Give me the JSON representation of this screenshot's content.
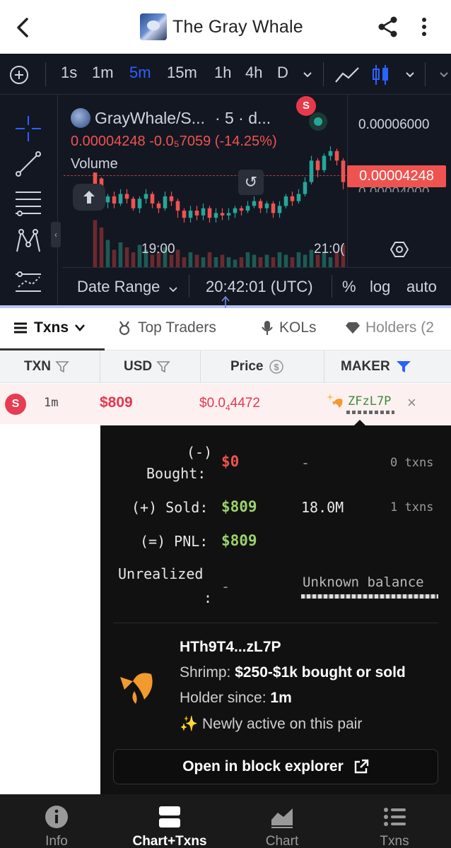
{
  "header": {
    "title": "The Gray Whale",
    "icons": [
      "back-icon",
      "share-icon",
      "more-vertical-icon"
    ]
  },
  "chart_toolbar": {
    "intervals": [
      "1s",
      "1m",
      "5m",
      "15m",
      "1h",
      "4h",
      "D"
    ],
    "active_interval": "5m"
  },
  "chart": {
    "pair": "GrayWhale/S...",
    "interval_label": "· 5 · d...",
    "s_marker": "S",
    "quote": "0.00004248 -0.0₅7059 (-14.25%)",
    "volume_label": "Volume",
    "axis_top": "0.00006000",
    "price_tag": "0.00004248",
    "price_ghost": "0.00004000",
    "x_ticks": [
      "19:00",
      "21:0("
    ],
    "candles": [
      [
        1.0,
        0.9,
        0.95,
        0.78,
        "down"
      ],
      [
        0.95,
        0.72,
        0.96,
        0.7,
        "down"
      ],
      [
        0.75,
        0.8,
        0.82,
        0.7,
        "up"
      ],
      [
        0.8,
        0.74,
        0.84,
        0.7,
        "down"
      ],
      [
        0.74,
        0.82,
        0.86,
        0.72,
        "up"
      ],
      [
        0.82,
        0.78,
        0.86,
        0.74,
        "down"
      ],
      [
        0.78,
        0.7,
        0.8,
        0.68,
        "down"
      ],
      [
        0.7,
        0.78,
        0.8,
        0.66,
        "up"
      ],
      [
        0.78,
        0.82,
        0.86,
        0.74,
        "up"
      ],
      [
        0.82,
        0.74,
        0.84,
        0.7,
        "down"
      ],
      [
        0.74,
        0.7,
        0.76,
        0.66,
        "down"
      ],
      [
        0.7,
        0.8,
        0.84,
        0.68,
        "up"
      ],
      [
        0.8,
        0.76,
        0.84,
        0.72,
        "down"
      ],
      [
        0.76,
        0.68,
        0.78,
        0.62,
        "down"
      ],
      [
        0.68,
        0.62,
        0.7,
        0.58,
        "down"
      ],
      [
        0.62,
        0.68,
        0.72,
        0.58,
        "up"
      ],
      [
        0.68,
        0.64,
        0.72,
        0.6,
        "down"
      ],
      [
        0.64,
        0.7,
        0.74,
        0.6,
        "up"
      ],
      [
        0.7,
        0.62,
        0.72,
        0.58,
        "down"
      ],
      [
        0.62,
        0.66,
        0.7,
        0.58,
        "up"
      ],
      [
        0.66,
        0.64,
        0.7,
        0.6,
        "down"
      ],
      [
        0.64,
        0.66,
        0.7,
        0.6,
        "up"
      ],
      [
        0.66,
        0.7,
        0.72,
        0.62,
        "up"
      ],
      [
        0.7,
        0.68,
        0.72,
        0.64,
        "down"
      ],
      [
        0.68,
        0.72,
        0.76,
        0.66,
        "up"
      ],
      [
        0.72,
        0.76,
        0.8,
        0.7,
        "up"
      ],
      [
        0.76,
        0.7,
        0.78,
        0.66,
        "down"
      ],
      [
        0.7,
        0.74,
        0.76,
        0.66,
        "up"
      ],
      [
        0.74,
        0.66,
        0.76,
        0.62,
        "down"
      ],
      [
        0.66,
        0.72,
        0.76,
        0.62,
        "up"
      ],
      [
        0.72,
        0.8,
        0.82,
        0.7,
        "up"
      ],
      [
        0.8,
        0.76,
        0.84,
        0.72,
        "down"
      ],
      [
        0.76,
        0.82,
        0.86,
        0.74,
        "up"
      ],
      [
        0.82,
        0.92,
        0.96,
        0.8,
        "up"
      ],
      [
        0.92,
        1.1,
        1.14,
        0.9,
        "up"
      ],
      [
        1.1,
        1.02,
        1.12,
        0.96,
        "down"
      ],
      [
        1.02,
        1.14,
        1.16,
        1.0,
        "up"
      ],
      [
        1.14,
        1.18,
        1.22,
        1.1,
        "up"
      ],
      [
        1.18,
        1.1,
        1.2,
        1.06,
        "down"
      ],
      [
        1.1,
        0.92,
        1.12,
        0.86,
        "down"
      ]
    ],
    "volumes": [
      0.95,
      0.8,
      0.55,
      0.35,
      0.5,
      0.4,
      0.3,
      0.45,
      0.35,
      0.25,
      0.3,
      0.4,
      0.25,
      0.35,
      0.2,
      0.3,
      0.25,
      0.2,
      0.3,
      0.2,
      0.25,
      0.2,
      0.15,
      0.2,
      0.3,
      0.25,
      0.2,
      0.25,
      0.2,
      0.3,
      0.25,
      0.2,
      0.3,
      0.25,
      0.35,
      0.25,
      0.3,
      0.2,
      0.3,
      0.45
    ],
    "bottom": {
      "date_range": "Date Range",
      "time": "20:42:01 (UTC)",
      "pct": "%",
      "log": "log",
      "auto": "auto"
    }
  },
  "tabs": [
    "Txns",
    "Top Traders",
    "KOLs",
    "Holders (2"
  ],
  "table": {
    "headers": [
      "TXN",
      "USD",
      "Price",
      "MAKER"
    ],
    "row": {
      "type": "S",
      "age": "1m",
      "usd": "$809",
      "price_prefix": "$0.0",
      "price_sub": "4",
      "price_rest": "4472",
      "maker": "ZFzL7P",
      "close": "×"
    }
  },
  "popup": {
    "bought_minus": "(-)",
    "bought_label": "Bought:",
    "bought_val": "$0",
    "bought_amt": "-",
    "bought_tx": "0 txns",
    "sold_prefix": "(+)",
    "sold_label": "Sold:",
    "sold_val": "$809",
    "sold_amt": "18.0M",
    "sold_tx": "1 txns",
    "pnl_prefix": "(=)",
    "pnl_label": "PNL:",
    "pnl_val": "$809",
    "unreal_label": "Unrealized",
    "unreal_colon": ":",
    "unreal_val": "-",
    "unreal_bal": "Unknown balance",
    "address": "HTh9T4...zL7P",
    "tier_label": "Shrimp:",
    "tier_desc": "$250-$1k bought or sold",
    "holder_label": "Holder since:",
    "holder_val": "1m",
    "new_active": "✨ Newly active on this pair",
    "explorer_btn": "Open in block explorer"
  },
  "bottom_nav": [
    "Info",
    "Chart+Txns",
    "Chart",
    "Txns"
  ],
  "colors": {
    "accent": "#2962ff",
    "up": "#26a69a",
    "down": "#ef5350",
    "red": "#e0394e",
    "green": "#9bd26b"
  }
}
